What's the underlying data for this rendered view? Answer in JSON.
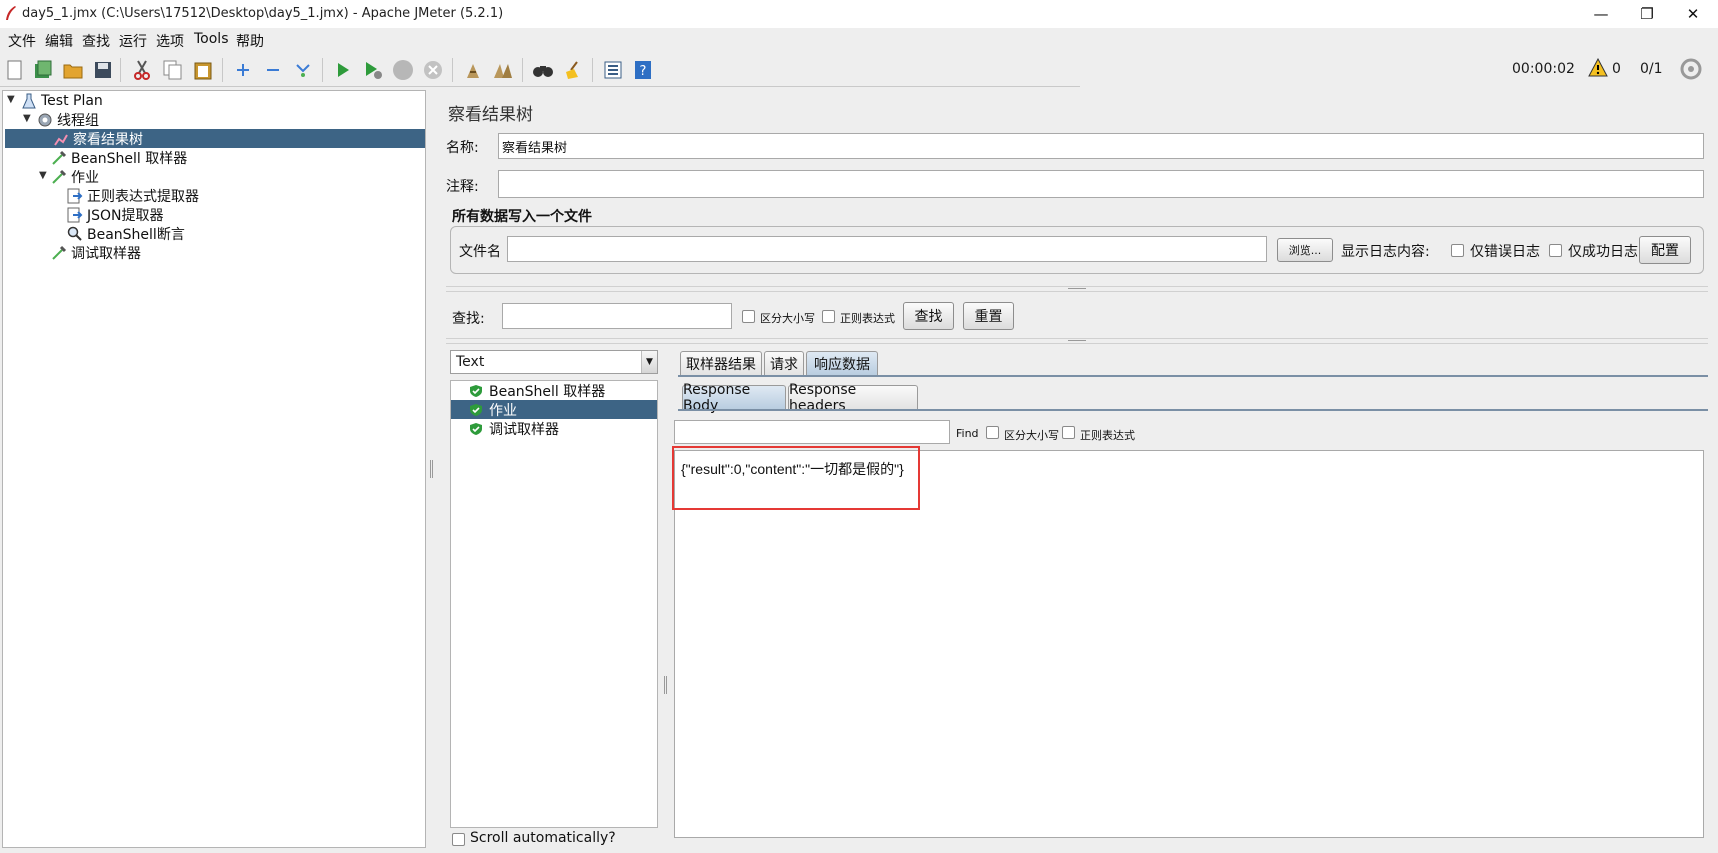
{
  "window": {
    "title": "day5_1.jmx (C:\\Users\\17512\\Desktop\\day5_1.jmx) - Apache JMeter (5.2.1)",
    "minimize": "—",
    "restore": "❐",
    "close": "✕"
  },
  "menu": [
    "文件",
    "编辑",
    "查找",
    "运行",
    "选项",
    "Tools",
    "帮助"
  ],
  "status": {
    "elapsed": "00:00:02",
    "warnings": "0",
    "threads": "0/1"
  },
  "tree": {
    "items": [
      {
        "label": "Test Plan",
        "icon": "flask-icon"
      },
      {
        "label": "线程组",
        "icon": "gear-icon"
      },
      {
        "label": "察看结果树",
        "icon": "chart-icon"
      },
      {
        "label": "BeanShell 取样器",
        "icon": "pipette-icon"
      },
      {
        "label": "作业",
        "icon": "pipette-icon"
      },
      {
        "label": "正则表达式提取器",
        "icon": "extractor-icon"
      },
      {
        "label": "JSON提取器",
        "icon": "extractor-icon"
      },
      {
        "label": "BeanShell断言",
        "icon": "magnifier-icon"
      },
      {
        "label": "调试取样器",
        "icon": "pipette-icon"
      }
    ]
  },
  "panel": {
    "title": "察看结果树",
    "name_label": "名称:",
    "name_value": "察看结果树",
    "comment_label": "注释:",
    "comment_value": "",
    "file_group_title": "所有数据写入一个文件",
    "filename_label": "文件名",
    "filename_value": "",
    "browse_button": "浏览...",
    "log_label": "显示日志内容:",
    "errors_only": "仅错误日志",
    "success_only": "仅成功日志",
    "config_button": "配置"
  },
  "search": {
    "label": "查找:",
    "value": "",
    "case_sensitive": "区分大小写",
    "regex": "正则表达式",
    "find_button": "查找",
    "reset_button": "重置"
  },
  "renderer": {
    "selected": "Text"
  },
  "results": [
    {
      "label": "BeanShell 取样器"
    },
    {
      "label": "作业"
    },
    {
      "label": "调试取样器"
    }
  ],
  "scroll_auto": "Scroll automatically?",
  "tabs": {
    "sampler_result": "取样器结果",
    "request": "请求",
    "response_data": "响应数据"
  },
  "subtabs": {
    "body": "Response Body",
    "headers": "Response headers"
  },
  "response_find": {
    "value": "",
    "find_label": "Find",
    "case_sensitive": "区分大小写",
    "regex": "正则表达式"
  },
  "response_body": "{\"result\":0,\"content\":\"一切都是假的\"}",
  "colors": {
    "selection": "#3d6485",
    "highlight_box": "#e53935"
  }
}
